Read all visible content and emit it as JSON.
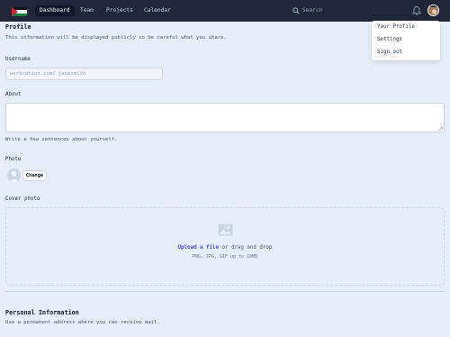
{
  "nav": {
    "items": [
      {
        "label": "Dashboard",
        "active": true
      },
      {
        "label": "Team",
        "active": false
      },
      {
        "label": "Projects",
        "active": false
      },
      {
        "label": "Calendar",
        "active": false
      }
    ],
    "search_placeholder": "Search"
  },
  "user_menu": {
    "items": [
      "Your Profile",
      "Settings",
      "Sign out"
    ]
  },
  "profile": {
    "title": "Profile",
    "description": "This information will be displayed publicly so be careful what you share.",
    "username_label": "Username",
    "username_value": "workcation.com/ janesmith",
    "about_label": "About",
    "about_value": "",
    "about_hint": "Write a few sentences about yourself.",
    "photo_label": "Photo",
    "change_button": "Change",
    "cover_label": "Cover photo",
    "upload_link": "Upload a file",
    "upload_rest": " or drag and drop",
    "upload_hint": "PNG, JPG, GIF up to 10MB"
  },
  "personal": {
    "title": "Personal Information",
    "description": "Use a permanent address where you can receive mail."
  },
  "colors": {
    "nav_bg": "#1e2637",
    "page_bg": "#e6eef9",
    "accent": "#4f46e5"
  }
}
